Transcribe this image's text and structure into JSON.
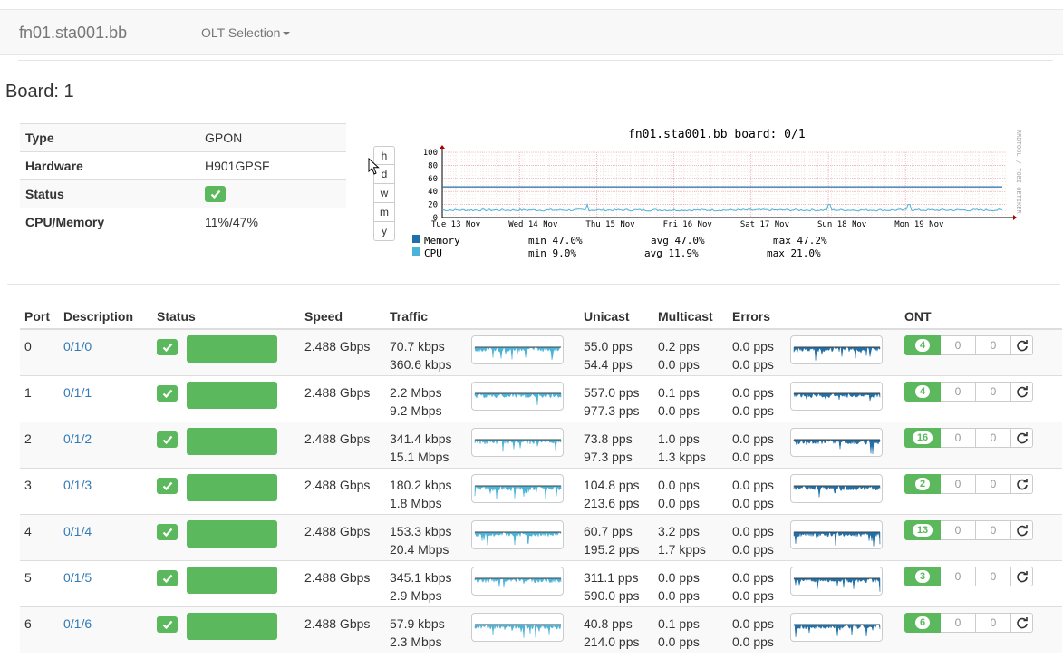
{
  "navbar": {
    "brand": "fn01.sta001.bb",
    "olt_selection": "OLT Selection"
  },
  "board": {
    "title": "Board: 1"
  },
  "info": [
    {
      "key": "Type",
      "value": "GPON"
    },
    {
      "key": "Hardware",
      "value": "H901GPSF"
    },
    {
      "key": "Status",
      "value": ""
    },
    {
      "key": "CPU/Memory",
      "value": "11%/47%"
    }
  ],
  "range_buttons": [
    "h",
    "d",
    "w",
    "m",
    "y"
  ],
  "graph": {
    "title": "fn01.sta001.bb board: 0/1",
    "side_label": "RRDTOOL / TOBI OETIKER",
    "y_ticks": [
      "100",
      "80",
      "60",
      "40",
      "20",
      "0"
    ],
    "x_ticks": [
      "Tue 13 Nov",
      "Wed 14 Nov",
      "Thu 15 Nov",
      "Fri 16 Nov",
      "Sat 17 Nov",
      "Sun 18 Nov",
      "Mon 19 Nov"
    ],
    "legend": [
      {
        "name": "Memory",
        "min": "min 47.0%",
        "avg": "avg 47.0%",
        "max": "max 47.2%",
        "color": "#1f6fa8"
      },
      {
        "name": "CPU",
        "min": "min 9.0%",
        "avg": "avg 11.9%",
        "max": "max 21.0%",
        "color": "#4ab3d8"
      }
    ],
    "memory_level": 47,
    "cpu_level": 12
  },
  "table": {
    "headers": {
      "port": "Port",
      "description": "Description",
      "status": "Status",
      "speed": "Speed",
      "traffic": "Traffic",
      "unicast": "Unicast",
      "multicast": "Multicast",
      "errors": "Errors",
      "ont": "ONT"
    },
    "rows": [
      {
        "port": "0",
        "desc": "0/1/0",
        "speed": "2.488 Gbps",
        "traffic_in": "70.7 kbps",
        "traffic_out": "360.6 kbps",
        "uni_in": "55.0 pps",
        "uni_out": "54.4 pps",
        "multi_in": "0.2 pps",
        "multi_out": "0.0 pps",
        "err_in": "0.0 pps",
        "err_out": "0.0 pps",
        "ont": "4",
        "ont_b": "0",
        "ont_c": "0"
      },
      {
        "port": "1",
        "desc": "0/1/1",
        "speed": "2.488 Gbps",
        "traffic_in": "2.2 Mbps",
        "traffic_out": "9.2 Mbps",
        "uni_in": "557.0 pps",
        "uni_out": "977.3 pps",
        "multi_in": "0.1 pps",
        "multi_out": "0.0 pps",
        "err_in": "0.0 pps",
        "err_out": "0.0 pps",
        "ont": "4",
        "ont_b": "0",
        "ont_c": "0"
      },
      {
        "port": "2",
        "desc": "0/1/2",
        "speed": "2.488 Gbps",
        "traffic_in": "341.4 kbps",
        "traffic_out": "15.1 Mbps",
        "uni_in": "73.8 pps",
        "uni_out": "97.3 pps",
        "multi_in": "1.0 pps",
        "multi_out": "1.3 kpps",
        "err_in": "0.0 pps",
        "err_out": "0.0 pps",
        "ont": "16",
        "ont_b": "0",
        "ont_c": "0"
      },
      {
        "port": "3",
        "desc": "0/1/3",
        "speed": "2.488 Gbps",
        "traffic_in": "180.2 kbps",
        "traffic_out": "1.8 Mbps",
        "uni_in": "104.8 pps",
        "uni_out": "213.6 pps",
        "multi_in": "0.0 pps",
        "multi_out": "0.0 pps",
        "err_in": "0.0 pps",
        "err_out": "0.0 pps",
        "ont": "2",
        "ont_b": "0",
        "ont_c": "0"
      },
      {
        "port": "4",
        "desc": "0/1/4",
        "speed": "2.488 Gbps",
        "traffic_in": "153.3 kbps",
        "traffic_out": "20.4 Mbps",
        "uni_in": "60.7 pps",
        "uni_out": "195.2 pps",
        "multi_in": "3.2 pps",
        "multi_out": "1.7 kpps",
        "err_in": "0.0 pps",
        "err_out": "0.0 pps",
        "ont": "13",
        "ont_b": "0",
        "ont_c": "0"
      },
      {
        "port": "5",
        "desc": "0/1/5",
        "speed": "2.488 Gbps",
        "traffic_in": "345.1 kbps",
        "traffic_out": "2.9 Mbps",
        "uni_in": "311.1 pps",
        "uni_out": "590.0 pps",
        "multi_in": "0.0 pps",
        "multi_out": "0.0 pps",
        "err_in": "0.0 pps",
        "err_out": "0.0 pps",
        "ont": "3",
        "ont_b": "0",
        "ont_c": "0"
      },
      {
        "port": "6",
        "desc": "0/1/6",
        "speed": "2.488 Gbps",
        "traffic_in": "57.9 kbps",
        "traffic_out": "2.3 Mbps",
        "uni_in": "40.8 pps",
        "uni_out": "214.0 pps",
        "multi_in": "0.1 pps",
        "multi_out": "0.0 pps",
        "err_in": "0.0 pps",
        "err_out": "0.0 pps",
        "ont": "6",
        "ont_b": "0",
        "ont_c": "0"
      }
    ]
  },
  "colors": {
    "success": "#5cb85c",
    "link": "#337ab7",
    "traffic_spark": "#4ab3d8",
    "unicast_spark": "#1f6fa8"
  },
  "icons": {
    "status": "check-icon",
    "refresh": "refresh-icon",
    "cursor": "mouse-pointer-icon"
  }
}
